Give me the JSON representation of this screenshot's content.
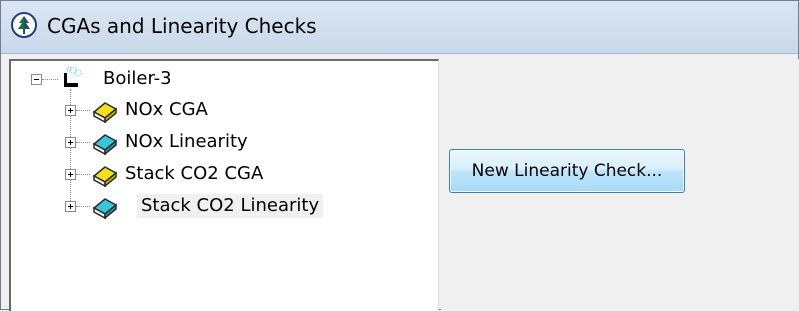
{
  "window": {
    "title": "CGAs and Linearity Checks"
  },
  "tree": {
    "root": {
      "label": "Boiler-3",
      "icon": "boiler-icon",
      "expanded": true
    },
    "items": [
      {
        "label": "NOx CGA",
        "icon": "yellow-book-icon",
        "color": "#f2e01c"
      },
      {
        "label": "NOx Linearity",
        "icon": "cyan-book-icon",
        "color": "#38c8d8"
      },
      {
        "label": "Stack CO2 CGA",
        "icon": "yellow-book-icon",
        "color": "#f2e01c"
      },
      {
        "label": "Stack CO2 Linearity",
        "icon": "cyan-book-icon",
        "color": "#38c8d8",
        "selected": true
      }
    ]
  },
  "actions": {
    "new_linearity_label": "New Linearity Check..."
  },
  "colors": {
    "titlebar": "#c9d8ea",
    "button_border": "#3c7fb1",
    "panel_background": "#f0f0f0"
  }
}
